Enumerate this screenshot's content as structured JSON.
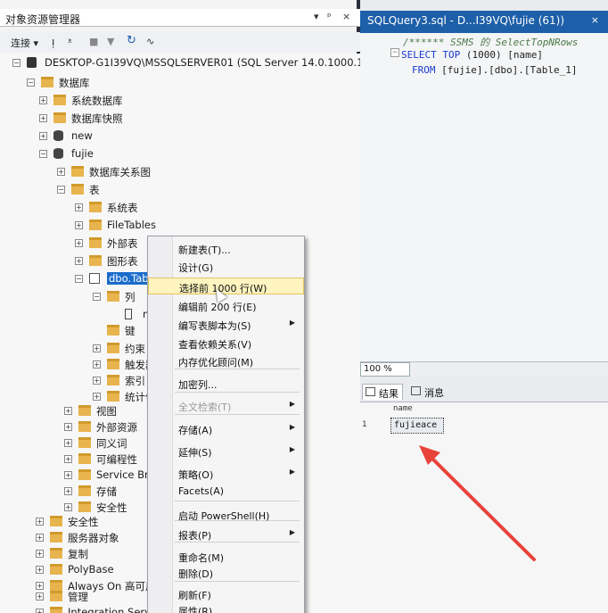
{
  "object_explorer": {
    "title": "对象资源管理器",
    "title_controls": [
      "▾",
      "ᵖ",
      "×"
    ],
    "toolbar": {
      "connect_label": "连接 ▾"
    },
    "tree": [
      {
        "label": "DESKTOP-G1I39VQ\\MSSQLSERVER01 (SQL Server 14.0.1000.1",
        "icon": "server",
        "expander": "−"
      },
      {
        "label": "数据库",
        "icon": "folder",
        "expander": "−"
      },
      {
        "label": "系统数据库",
        "icon": "folder",
        "expander": "+"
      },
      {
        "label": "数据库快照",
        "icon": "folder",
        "expander": "+"
      },
      {
        "label": "new",
        "icon": "db",
        "expander": "+"
      },
      {
        "label": "fujie",
        "icon": "db",
        "expander": "−"
      },
      {
        "label": "数据库关系图",
        "icon": "folder",
        "expander": "+"
      },
      {
        "label": "表",
        "icon": "folder",
        "expander": "−"
      },
      {
        "label": "系统表",
        "icon": "folder",
        "expander": "+"
      },
      {
        "label": "FileTables",
        "icon": "folder",
        "expander": "+"
      },
      {
        "label": "外部表",
        "icon": "folder",
        "expander": "+"
      },
      {
        "label": "图形表",
        "icon": "folder",
        "expander": "+"
      },
      {
        "label": "dbo.Tab",
        "icon": "table",
        "expander": "−"
      },
      {
        "label": "列",
        "icon": "folder",
        "expander": "−"
      },
      {
        "label": "na",
        "icon": "col",
        "expander": ""
      },
      {
        "label": "键",
        "icon": "folder",
        "expander": ""
      },
      {
        "label": "约束",
        "icon": "folder",
        "expander": "+"
      },
      {
        "label": "触发器",
        "icon": "folder",
        "expander": "+"
      },
      {
        "label": "索引",
        "icon": "folder",
        "expander": "+"
      },
      {
        "label": "统计信",
        "icon": "folder",
        "expander": "+"
      },
      {
        "label": "视图",
        "icon": "folder",
        "expander": "+"
      },
      {
        "label": "外部资源",
        "icon": "folder",
        "expander": "+"
      },
      {
        "label": "同义词",
        "icon": "folder",
        "expander": "+"
      },
      {
        "label": "可编程性",
        "icon": "folder",
        "expander": "+"
      },
      {
        "label": "Service Brok",
        "icon": "folder",
        "expander": "+"
      },
      {
        "label": "存储",
        "icon": "folder",
        "expander": "+"
      },
      {
        "label": "安全性",
        "icon": "folder",
        "expander": "+"
      },
      {
        "label": "安全性",
        "icon": "folder",
        "expander": "+"
      },
      {
        "label": "服务器对象",
        "icon": "folder",
        "expander": "+"
      },
      {
        "label": "复制",
        "icon": "folder",
        "expander": "+"
      },
      {
        "label": "PolyBase",
        "icon": "folder",
        "expander": "+"
      },
      {
        "label": "Always On 高可用性",
        "icon": "folder",
        "expander": "+"
      },
      {
        "label": "管理",
        "icon": "folder",
        "expander": "+"
      },
      {
        "label": "Integration Servic",
        "icon": "folder",
        "expander": "+"
      }
    ]
  },
  "context_menu": {
    "items": [
      {
        "label": "新建表(T)...",
        "submenu": false,
        "disabled": false,
        "highlighted": false
      },
      {
        "label": "设计(G)",
        "submenu": false,
        "disabled": false,
        "highlighted": false
      },
      {
        "label": "选择前 1000 行(W)",
        "submenu": false,
        "disabled": false,
        "highlighted": true
      },
      {
        "label": "编辑前 200 行(E)",
        "submenu": false,
        "disabled": false,
        "highlighted": false
      },
      {
        "label": "编写表脚本为(S)",
        "submenu": true,
        "disabled": false,
        "highlighted": false
      },
      {
        "label": "查看依赖关系(V)",
        "submenu": false,
        "disabled": false,
        "highlighted": false
      },
      {
        "label": "内存优化顾问(M)",
        "submenu": false,
        "disabled": false,
        "highlighted": false
      },
      {
        "label": "加密列...",
        "submenu": false,
        "disabled": false,
        "highlighted": false
      },
      {
        "label": "全文检索(T)",
        "submenu": true,
        "disabled": true,
        "highlighted": false
      },
      {
        "label": "存储(A)",
        "submenu": true,
        "disabled": false,
        "highlighted": false
      },
      {
        "label": "延伸(S)",
        "submenu": true,
        "disabled": false,
        "highlighted": false
      },
      {
        "label": "策略(O)",
        "submenu": true,
        "disabled": false,
        "highlighted": false
      },
      {
        "label": "Facets(A)",
        "submenu": false,
        "disabled": false,
        "highlighted": false
      },
      {
        "label": "启动 PowerShell(H)",
        "submenu": false,
        "disabled": false,
        "highlighted": false
      },
      {
        "label": "报表(P)",
        "submenu": true,
        "disabled": false,
        "highlighted": false
      },
      {
        "label": "重命名(M)",
        "submenu": false,
        "disabled": false,
        "highlighted": false
      },
      {
        "label": "删除(D)",
        "submenu": false,
        "disabled": false,
        "highlighted": false
      },
      {
        "label": "刷新(F)",
        "submenu": false,
        "disabled": false,
        "highlighted": false
      },
      {
        "label": "属性(R)",
        "submenu": false,
        "disabled": false,
        "highlighted": false
      }
    ]
  },
  "query_editor": {
    "tab_title": "SQLQuery3.sql - D...I39VQ\\fujie (61))",
    "tab_close": "×",
    "code": {
      "comment": "/****** SSMS 的 SelectTopNRows",
      "line1_kw1": "SELECT",
      "line1_kw2": "TOP",
      "line1_rest": "(1000) [name]",
      "line2_kw": "FROM",
      "line2_rest": "[fujie].[dbo].[Table_1]",
      "collapse": "−"
    },
    "zoom": "100 %"
  },
  "results": {
    "tabs": [
      {
        "label": "结果"
      },
      {
        "label": "消息"
      }
    ],
    "columns": [
      "name"
    ],
    "rows": [
      {
        "num": "1",
        "name": "fujieace"
      }
    ]
  },
  "colors": {
    "tab_blue": "#1d5fa8",
    "selection_blue": "#1c6ccb",
    "menu_highlight": "#fdf4bf",
    "annotation_arrow": "#e8433b"
  }
}
